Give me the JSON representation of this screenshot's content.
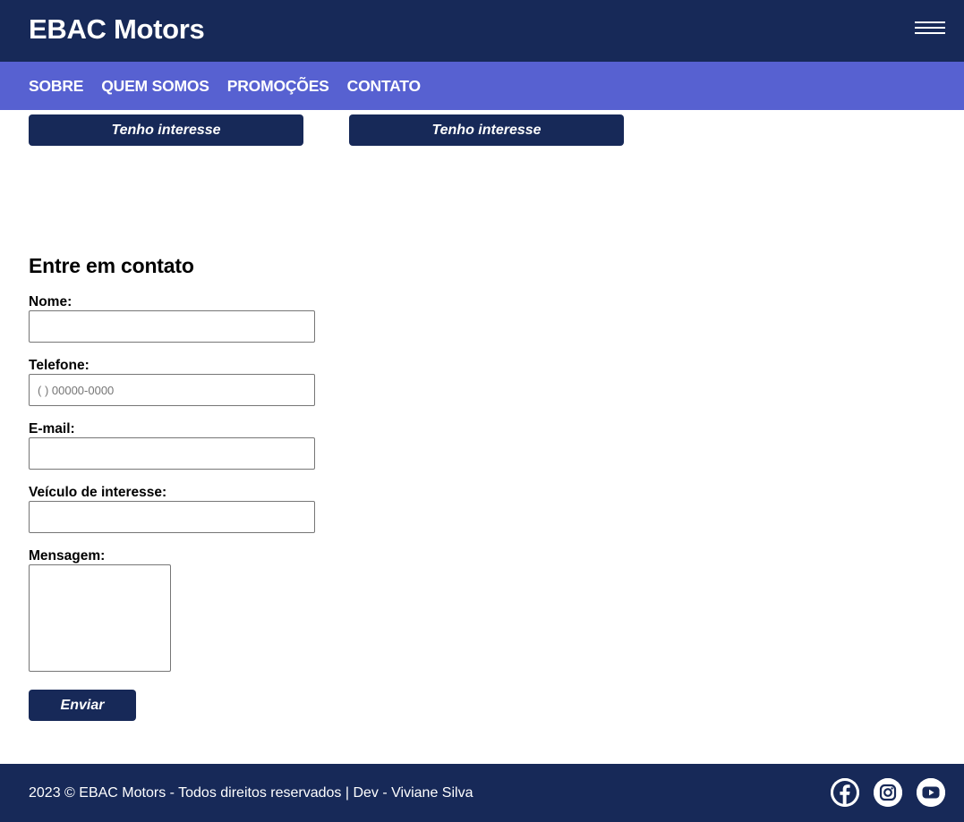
{
  "header": {
    "logo": "EBAC Motors",
    "menu_icon": "hamburger-menu-icon"
  },
  "nav": {
    "items": [
      {
        "label": "SOBRE"
      },
      {
        "label": "QUEM SOMOS"
      },
      {
        "label": "PROMOÇÕES"
      },
      {
        "label": "CONTATO"
      }
    ]
  },
  "products": {
    "interest_buttons": [
      {
        "label": "Tenho interesse"
      },
      {
        "label": "Tenho interesse"
      }
    ]
  },
  "contact": {
    "title": "Entre em contato",
    "fields": {
      "nome": {
        "label": "Nome:",
        "value": "",
        "placeholder": ""
      },
      "telefone": {
        "label": "Telefone:",
        "value": "",
        "placeholder": "( ) 00000-0000"
      },
      "email": {
        "label": "E-mail:",
        "value": "",
        "placeholder": ""
      },
      "veiculo": {
        "label": "Veículo de interesse:",
        "value": "",
        "placeholder": ""
      },
      "mensagem": {
        "label": "Mensagem:",
        "value": ""
      }
    },
    "submit_label": "Enviar"
  },
  "footer": {
    "text": "2023 © EBAC Motors - Todos direitos reservados | Dev - Viviane Silva",
    "social": [
      {
        "icon": "facebook-icon"
      },
      {
        "icon": "instagram-icon"
      },
      {
        "icon": "youtube-icon"
      }
    ]
  },
  "colors": {
    "primary": "#172958",
    "nav": "#5761d1",
    "background": "#ffffff"
  }
}
